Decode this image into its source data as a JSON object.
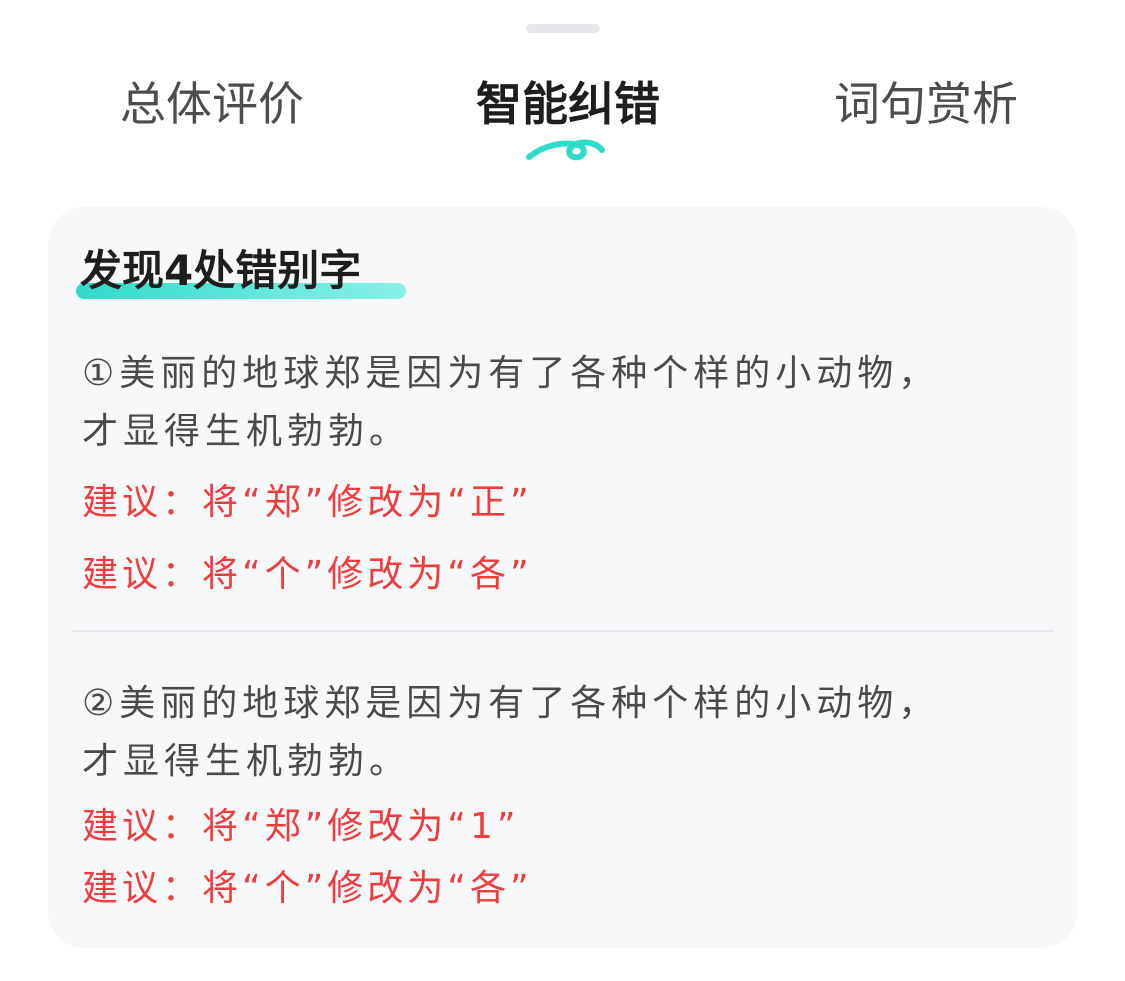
{
  "tabs": [
    {
      "label": "总体评价",
      "active": false
    },
    {
      "label": "智能纠错",
      "active": true
    },
    {
      "label": "词句赏析",
      "active": false
    }
  ],
  "colors": {
    "accent": "#2fdcc8",
    "error_text": "#f03c3c",
    "card_bg": "#f7f8fa"
  },
  "card": {
    "title": "发现4处错别字",
    "items": [
      {
        "sentence": "①美丽的地球郑是因为有了各种个样的小动物，才显得生机勃勃。",
        "suggestions": [
          "建议：将“郑”修改为“正”",
          "建议：将“个”修改为“各”"
        ]
      },
      {
        "sentence": "②美丽的地球郑是因为有了各种个样的小动物，才显得生机勃勃。",
        "suggestions": [
          "建议：将“郑”修改为“1”",
          "建议：将“个”修改为“各”"
        ]
      }
    ]
  }
}
